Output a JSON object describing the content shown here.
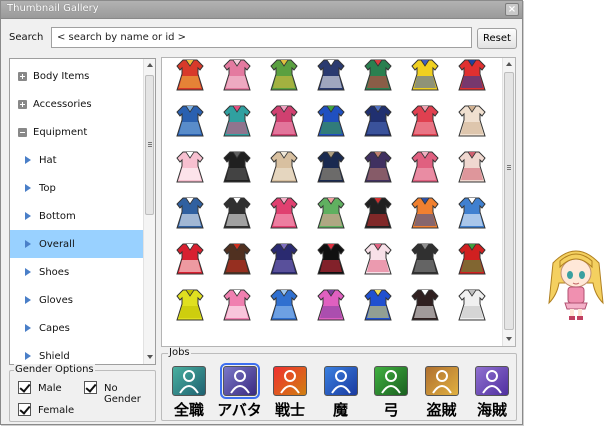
{
  "window": {
    "title": "Thumbnail Gallery",
    "close_label": "×"
  },
  "search": {
    "label": "Search",
    "placeholder": "< search by name or id >",
    "value": "",
    "reset_label": "Reset"
  },
  "tree": {
    "items": [
      {
        "label": "Body Items",
        "kind": "plus"
      },
      {
        "label": "Accessories",
        "kind": "plus"
      },
      {
        "label": "Equipment",
        "kind": "minus"
      },
      {
        "label": "Hat",
        "kind": "child"
      },
      {
        "label": "Top",
        "kind": "child"
      },
      {
        "label": "Bottom",
        "kind": "child"
      },
      {
        "label": "Overall",
        "kind": "child",
        "selected": true
      },
      {
        "label": "Shoes",
        "kind": "child"
      },
      {
        "label": "Gloves",
        "kind": "child"
      },
      {
        "label": "Capes",
        "kind": "child"
      },
      {
        "label": "Shield",
        "kind": "child"
      }
    ]
  },
  "gender": {
    "legend": "Gender Options",
    "options": [
      {
        "label": "Male",
        "checked": true
      },
      {
        "label": "No Gender",
        "checked": true
      },
      {
        "label": "Female",
        "checked": true
      }
    ]
  },
  "gallery": {
    "items": [
      {
        "icon": "overall-icon",
        "colors": [
          "#d83a2a",
          "#f0c040"
        ]
      },
      {
        "icon": "overall-icon",
        "colors": [
          "#e47aa0",
          "#f4d0dc"
        ]
      },
      {
        "icon": "overall-icon",
        "colors": [
          "#5aa040",
          "#e0c040"
        ]
      },
      {
        "icon": "overall-icon",
        "colors": [
          "#2a3a70",
          "#ffffff"
        ]
      },
      {
        "icon": "overall-icon",
        "colors": [
          "#2a8050",
          "#d84040"
        ]
      },
      {
        "icon": "overall-icon",
        "colors": [
          "#f0d020",
          "#4060c0"
        ]
      },
      {
        "icon": "overall-icon",
        "colors": [
          "#e03030",
          "#2040a0"
        ]
      },
      {
        "icon": "overall-icon",
        "colors": [
          "#2a60b0",
          "#80b0e0"
        ]
      },
      {
        "icon": "overall-icon",
        "colors": [
          "#30a0a0",
          "#e05080"
        ]
      },
      {
        "icon": "overall-icon",
        "colors": [
          "#d04070",
          "#f0a0c0"
        ]
      },
      {
        "icon": "overall-icon",
        "colors": [
          "#2050c0",
          "#40a040"
        ]
      },
      {
        "icon": "overall-icon",
        "colors": [
          "#203070",
          "#5070c0"
        ]
      },
      {
        "icon": "overall-icon",
        "colors": [
          "#e04050",
          "#f0a0b0"
        ]
      },
      {
        "icon": "overall-icon",
        "colors": [
          "#f0e0d0",
          "#d0b090"
        ]
      },
      {
        "icon": "overall-icon",
        "colors": [
          "#f8c0d0",
          "#ffffff"
        ]
      },
      {
        "icon": "overall-icon",
        "colors": [
          "#202020",
          "#606060"
        ]
      },
      {
        "icon": "overall-icon",
        "colors": [
          "#d8c0a0",
          "#f0e8d8"
        ]
      },
      {
        "icon": "overall-icon",
        "colors": [
          "#1a2a50",
          "#b0a080"
        ]
      },
      {
        "icon": "overall-icon",
        "colors": [
          "#403060",
          "#c08070"
        ]
      },
      {
        "icon": "overall-icon",
        "colors": [
          "#e06080",
          "#f0b0c0"
        ]
      },
      {
        "icon": "overall-icon",
        "colors": [
          "#f0d8d0",
          "#d06070"
        ]
      },
      {
        "icon": "overall-icon",
        "colors": [
          "#3060a0",
          "#ffffff"
        ]
      },
      {
        "icon": "overall-icon",
        "colors": [
          "#303030",
          "#ffffff"
        ]
      },
      {
        "icon": "overall-icon",
        "colors": [
          "#e04070",
          "#f8b0c8"
        ]
      },
      {
        "icon": "overall-icon",
        "colors": [
          "#60b060",
          "#f0a0a0"
        ]
      },
      {
        "icon": "overall-icon",
        "colors": [
          "#202020",
          "#d03030"
        ]
      },
      {
        "icon": "overall-icon",
        "colors": [
          "#f08030",
          "#3050a0"
        ]
      },
      {
        "icon": "overall-icon",
        "colors": [
          "#4080d0",
          "#ffffff"
        ]
      },
      {
        "icon": "overall-icon",
        "colors": [
          "#d82030",
          "#ffffff"
        ]
      },
      {
        "icon": "overall-icon",
        "colors": [
          "#503020",
          "#d03020"
        ]
      },
      {
        "icon": "overall-icon",
        "colors": [
          "#2a2a70",
          "#8070c0"
        ]
      },
      {
        "icon": "overall-icon",
        "colors": [
          "#101010",
          "#e03040"
        ]
      },
      {
        "icon": "overall-icon",
        "colors": [
          "#f8e0e8",
          "#e06080"
        ]
      },
      {
        "icon": "overall-icon",
        "colors": [
          "#303030",
          "#909090"
        ]
      },
      {
        "icon": "overall-icon",
        "colors": [
          "#d02020",
          "#40a040"
        ]
      },
      {
        "icon": "overall-icon",
        "colors": [
          "#e0e020",
          "#c0c000"
        ]
      },
      {
        "icon": "overall-icon",
        "colors": [
          "#f080b0",
          "#ffffff"
        ]
      },
      {
        "icon": "overall-icon",
        "colors": [
          "#3070d0",
          "#a0c8f0"
        ]
      },
      {
        "icon": "overall-icon",
        "colors": [
          "#e060c0",
          "#8040a0"
        ]
      },
      {
        "icon": "overall-icon",
        "colors": [
          "#2050d0",
          "#f0e060"
        ]
      },
      {
        "icon": "overall-icon",
        "colors": [
          "#302020",
          "#ffffff"
        ]
      },
      {
        "icon": "overall-icon",
        "colors": [
          "#f0f0f0",
          "#c0c0c0"
        ]
      }
    ]
  },
  "jobs": {
    "legend": "Jobs",
    "items": [
      {
        "label": "全職",
        "colors": [
          "#4ab0a0",
          "#1e6070"
        ]
      },
      {
        "label": "アバタ",
        "colors": [
          "#7a78c8",
          "#3b2a80"
        ],
        "selected": true
      },
      {
        "label": "戦士",
        "colors": [
          "#f03030",
          "#d08010"
        ]
      },
      {
        "label": "魔",
        "colors": [
          "#3a80e0",
          "#1a3aa0"
        ]
      },
      {
        "label": "弓",
        "colors": [
          "#40b040",
          "#1a6020"
        ]
      },
      {
        "label": "盗賊",
        "colors": [
          "#b07030",
          "#e0b040"
        ]
      },
      {
        "label": "海賊",
        "colors": [
          "#9070d0",
          "#5030a0"
        ]
      }
    ]
  },
  "mascot": {
    "icon": "character-icon",
    "colors": [
      "#f4d060",
      "#f090b0"
    ]
  }
}
